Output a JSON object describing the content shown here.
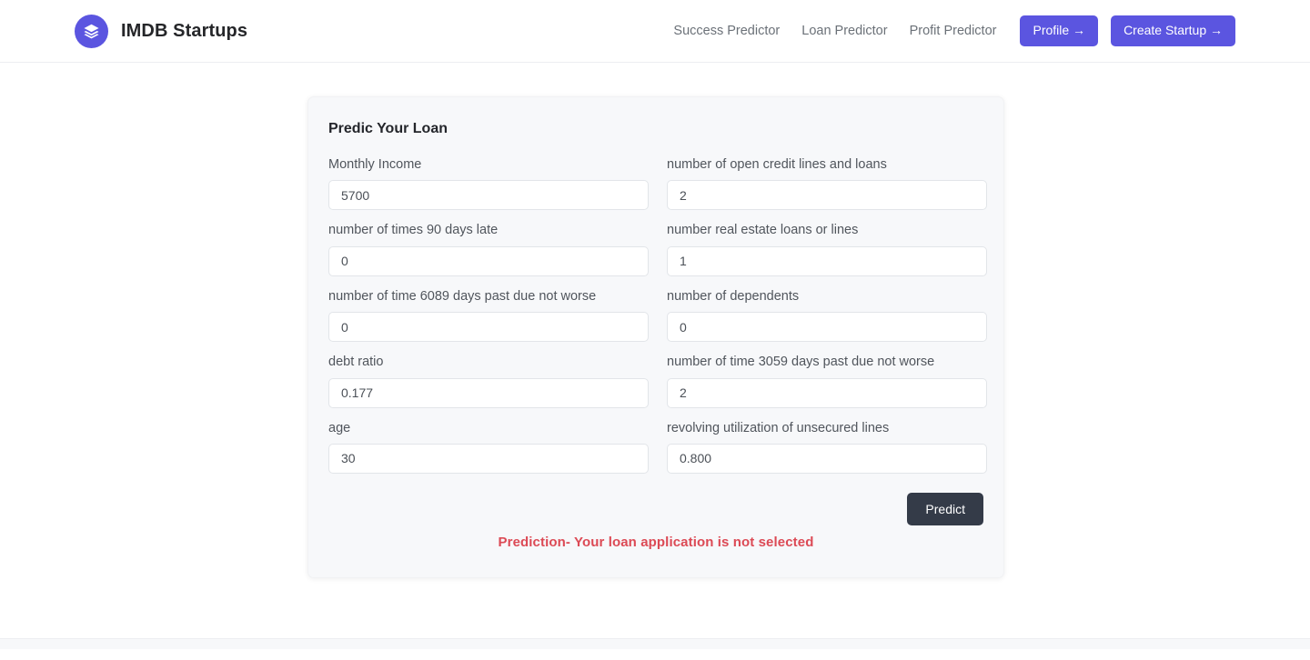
{
  "header": {
    "brand_name": "IMDB Startups",
    "logo_icon": "layers-icon",
    "logo_color": "#5b55e0",
    "nav_links": [
      {
        "label": "Success Predictor"
      },
      {
        "label": "Loan Predictor"
      },
      {
        "label": "Profit Predictor"
      }
    ],
    "buttons": [
      {
        "label": "Profile →"
      },
      {
        "label": "Create Startup →"
      }
    ]
  },
  "card": {
    "title": "Predic Your Loan",
    "fields": [
      {
        "label": "Monthly Income",
        "value": "5700"
      },
      {
        "label": "number of open credit lines and loans",
        "value": "2"
      },
      {
        "label": "number of times 90 days late",
        "value": "0"
      },
      {
        "label": "number real estate loans or lines",
        "value": "1"
      },
      {
        "label": "number of time 6089 days past due not worse",
        "value": "0"
      },
      {
        "label": "number of dependents",
        "value": "0"
      },
      {
        "label": "debt ratio",
        "value": "0.177"
      },
      {
        "label": "number of time 3059 days past due not worse",
        "value": "2"
      },
      {
        "label": "age",
        "value": "30"
      },
      {
        "label": "revolving utilization of unsecured lines",
        "value": "0.800"
      }
    ],
    "submit_label": "Predict",
    "prediction_text": "Prediction- Your loan application is not selected",
    "prediction_color": "#dc4a55"
  }
}
